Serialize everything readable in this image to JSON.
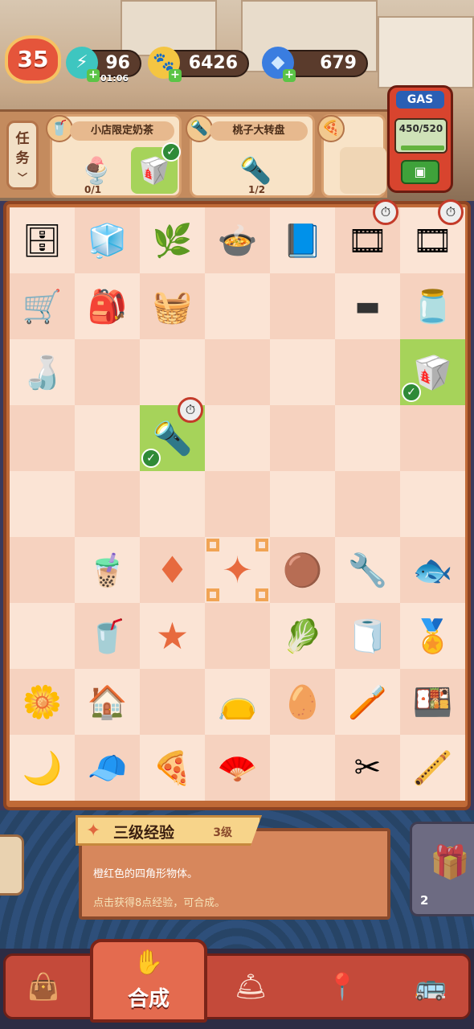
{
  "header": {
    "level": "35",
    "energy": {
      "value": "96",
      "timer": "01:06",
      "icon": "lightning-icon"
    },
    "coins": {
      "value": "6426",
      "icon": "paw-coin-icon"
    },
    "gems": {
      "value": "679",
      "icon": "diamond-icon"
    }
  },
  "gas": {
    "label": "GAS",
    "reading": "450/520",
    "fill_fraction": 0.87
  },
  "tasks": {
    "side_label": "任务",
    "cards": [
      {
        "title": "小店限定奶茶",
        "progress": "0/1"
      },
      {
        "title": "桃子大转盘",
        "progress": "1/2"
      }
    ]
  },
  "board": {
    "rows": [
      [
        "shelf",
        "fridge",
        "bonsai",
        "steamer-pot",
        "notebook",
        "film-roll",
        "film-roll-pair"
      ],
      [
        "cart",
        "bag",
        "cloth-bundle",
        "",
        "",
        "film-piece",
        "jar"
      ],
      [
        "soy-bottle",
        "",
        "",
        "",
        "",
        "",
        "takeout-box"
      ],
      [
        "",
        "",
        "flashlight",
        "",
        "",
        "",
        ""
      ],
      [
        "",
        "",
        "",
        "",
        "",
        "",
        ""
      ],
      [
        "",
        "milk-tea",
        "gem-shard",
        "gem-star",
        "meatball",
        "pliers",
        "fish-plate"
      ],
      [
        "",
        "juice-cup",
        "star-gem",
        "",
        "cabbage",
        "towel",
        "medal"
      ],
      [
        "flower",
        "house",
        "",
        "pouch",
        "egg",
        "brush",
        "bento"
      ],
      [
        "moon",
        "cap",
        "pizza",
        "paper-fan",
        "",
        "scissors",
        "pipe"
      ]
    ]
  },
  "info": {
    "name": "三级经验",
    "level": "3级",
    "desc1": "橙红色的四角形物体。",
    "desc2": "点击获得8点经验，可合成。",
    "right_count": "2"
  },
  "nav": {
    "active_label": "合成"
  }
}
